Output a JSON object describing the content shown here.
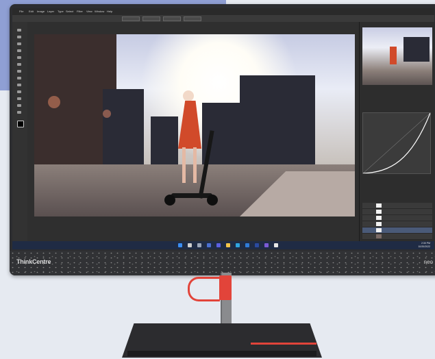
{
  "photo": {
    "subject": "woman in red dress riding an electric scooter on a city street at sunset",
    "palette": {
      "sky": "#e9ecf6",
      "dress": "#d14a2a",
      "buildings": "#2a2b36",
      "road": "#6e6360"
    }
  },
  "monitor": {
    "brand": "ThinkCentre",
    "brand_right": "neo",
    "accent_color": "#e2443a"
  },
  "app": {
    "menu_items": [
      "File",
      "Edit",
      "Image",
      "Layer",
      "Type",
      "Select",
      "Filter",
      "View",
      "Window",
      "Help"
    ],
    "panels": [
      "Navigator",
      "Properties",
      "Layers"
    ]
  },
  "taskbar": {
    "time": "2:30 PM",
    "date": "10/20/2022"
  }
}
